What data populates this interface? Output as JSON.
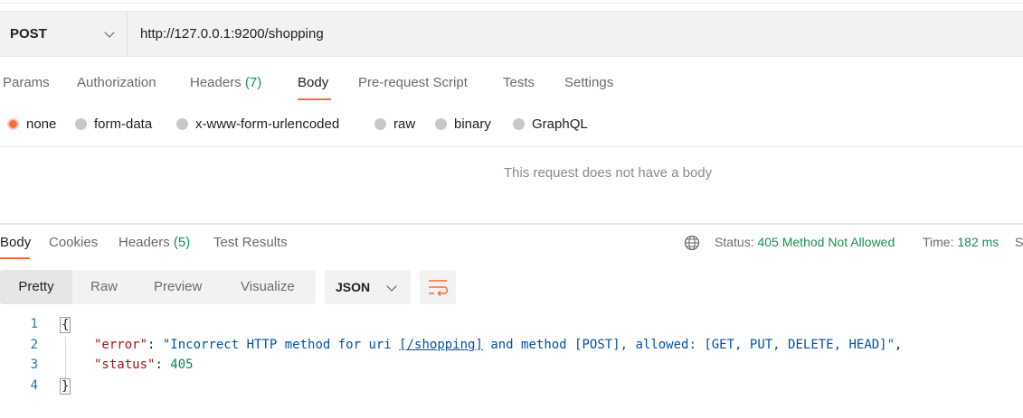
{
  "request": {
    "method": "POST",
    "url": "http://127.0.0.1:9200/shopping",
    "tabs": [
      {
        "label": "Params"
      },
      {
        "label": "Authorization"
      },
      {
        "label": "Headers",
        "count": "(7)"
      },
      {
        "label": "Body"
      },
      {
        "label": "Pre-request Script"
      },
      {
        "label": "Tests"
      },
      {
        "label": "Settings"
      }
    ],
    "active_tab": "Body",
    "body_types": [
      "none",
      "form-data",
      "x-www-form-urlencoded",
      "raw",
      "binary",
      "GraphQL"
    ],
    "selected_body_type": "none",
    "empty_message": "This request does not have a body"
  },
  "response": {
    "tabs": [
      {
        "label": "Body"
      },
      {
        "label": "Cookies"
      },
      {
        "label": "Headers",
        "count": "(5)"
      },
      {
        "label": "Test Results"
      }
    ],
    "active_tab": "Body",
    "status_label": "Status:",
    "status_value": "405 Method Not Allowed",
    "time_label": "Time:",
    "time_value": "182 ms",
    "size_label_partial": "S",
    "view_modes": [
      "Pretty",
      "Raw",
      "Preview",
      "Visualize"
    ],
    "active_view_mode": "Pretty",
    "format": "JSON",
    "code": {
      "line_numbers": [
        "1",
        "2",
        "3",
        "4"
      ],
      "open_brace": "{",
      "close_brace": "}",
      "error_key": "\"error\"",
      "error_prefix": "\"Incorrect HTTP method for uri ",
      "error_uri": "[/shopping]",
      "error_suffix": " and method [POST], allowed: [GET, PUT, DELETE, HEAD]\"",
      "status_key": "\"status\"",
      "status_value": "405"
    }
  },
  "colors": {
    "accent": "#ff6c37",
    "status_green": "#1a8f55"
  }
}
